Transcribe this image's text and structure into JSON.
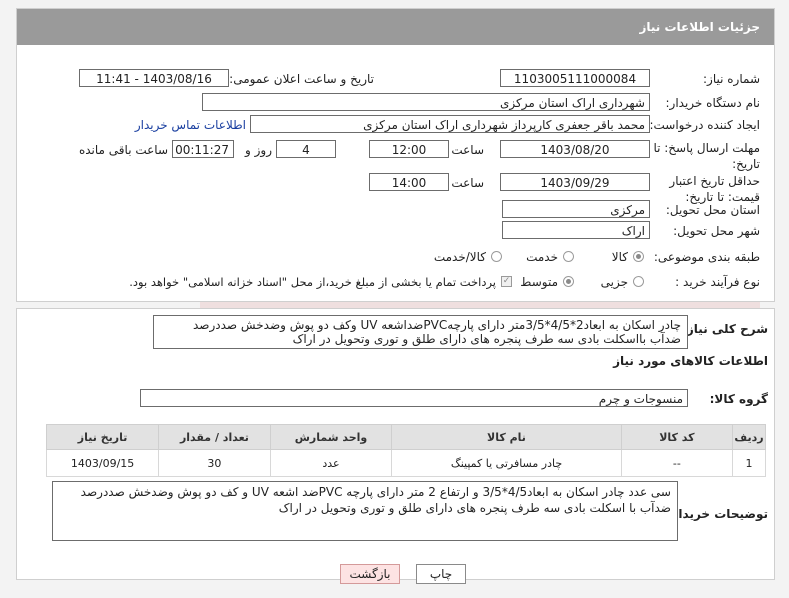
{
  "header": {
    "title": "جزئیات اطلاعات نیاز"
  },
  "fields": {
    "need_number_label": "شماره نیاز:",
    "need_number": "1103005111000084",
    "announce_label": "تاریخ و ساعت اعلان عمومی:",
    "announce_value": "1403/08/16 - 11:41",
    "buyer_org_label": "نام دستگاه خریدار:",
    "buyer_org": "شهرداری اراک استان مرکزی",
    "creator_label": "ایجاد کننده درخواست:",
    "creator": "محمد باقر جعفری کارپرداز شهرداری اراک استان مرکزی",
    "contact_link": "اطلاعات تماس خریدار",
    "reply_deadline_label": "مهلت ارسال پاسخ: تا تاریخ:",
    "reply_date": "1403/08/20",
    "time_label": "ساعت",
    "reply_time": "12:00",
    "days_value": "4",
    "days_label": "روز و",
    "remaining_time": "00:11:27",
    "remaining_label": "ساعت باقی مانده",
    "price_validity_label": "حداقل تاریخ اعتبار قیمت: تا تاریخ:",
    "price_date": "1403/09/29",
    "price_time": "14:00",
    "province_label": "استان محل تحویل:",
    "province": "مرکزی",
    "city_label": "شهر محل تحویل:",
    "city": "اراک",
    "category_label": "طبقه بندی موضوعی:",
    "category_goods": "کالا",
    "category_service": "خدمت",
    "category_both": "کالا/خدمت",
    "process_label": "نوع فرآیند خرید :",
    "process_partial": "جزیی",
    "process_medium": "متوسط",
    "process_note": "پرداخت تمام یا بخشی از مبلغ خرید،از محل \"اسناد خزانه اسلامی\" خواهد بود."
  },
  "summary": {
    "label": "شرح کلی نیاز:",
    "text": "چادر اسکان به ابعاد2*4/5*3/5متر دارای پارچهPVCضداشعه UV وکف دو پوش وضدخش صددرصد ضدآب بااسکلت بادی سه طرف پنجره های دارای طلق و توری وتحویل در اراک"
  },
  "goods": {
    "section_title": "اطلاعات کالاهای مورد نیاز",
    "group_label": "گروه کالا:",
    "group_value": "منسوجات و چرم",
    "columns": [
      "ردیف",
      "کد کالا",
      "نام کالا",
      "واحد شمارش",
      "تعداد / مقدار",
      "تاریخ نیاز"
    ],
    "rows": [
      {
        "index": "1",
        "code": "--",
        "name": "چادر مسافرتی یا کمپینگ",
        "unit": "عدد",
        "qty": "30",
        "date": "1403/09/15"
      }
    ]
  },
  "buyer_notes": {
    "label": "توضیحات خریدار:",
    "text": "سی عدد چادر اسکان به ابعاد4/5*3/5 و ارتفاع 2 متر دارای پارچه PVCضد اشعه UV و کف دو پوش وضدخش صددرصد ضدآب با اسکلت بادی سه طرف پنجره های دارای طلق و توری وتحویل در اراک"
  },
  "buttons": {
    "print": "چاپ",
    "back": "بازگشت"
  },
  "colors": {
    "header_bg": "#9a9a9a",
    "back_button_bg": "#fde3e3",
    "link": "#1a3fa0"
  }
}
